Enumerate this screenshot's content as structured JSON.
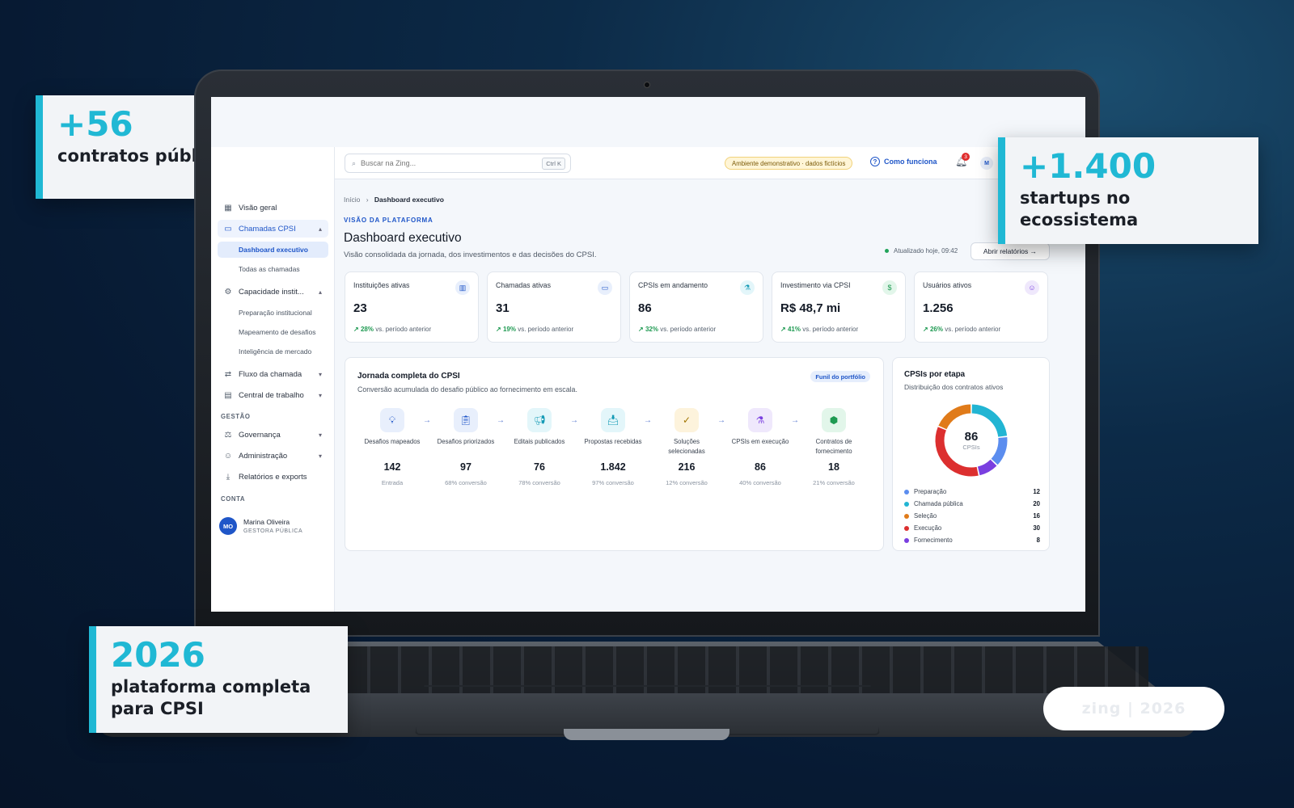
{
  "callouts": {
    "contracts": {
      "value": "+56",
      "label": "contratos públicos"
    },
    "startups": {
      "value": "+1.400",
      "label_line1": "startups no",
      "label_line2": "ecossistema"
    },
    "year": {
      "value": "2026",
      "label_line1": "plataforma completa",
      "label_line2": "para CPSI"
    }
  },
  "watermark": "zing | 2026",
  "topbar": {
    "search_placeholder": "Buscar na Zing...",
    "search_shortcut": "Ctrl K",
    "demo_badge": "Ambiente demonstrativo · dados fictícios",
    "how_it_works": "Como funciona",
    "notification_count": "3",
    "avatar_initial": "M"
  },
  "sidebar": {
    "items": [
      {
        "label": "Visão geral",
        "icon": "grid-icon"
      },
      {
        "label": "Chamadas CPSI",
        "icon": "folder-icon"
      },
      {
        "label": "Dashboard executivo"
      },
      {
        "label": "Todas as chamadas"
      },
      {
        "label": "Capacidade instit...",
        "icon": "sliders-icon"
      },
      {
        "label": "Preparação institucional"
      },
      {
        "label": "Mapeamento de desafios"
      },
      {
        "label": "Inteligência de mercado"
      },
      {
        "label": "Fluxo da chamada",
        "icon": "flow-icon"
      },
      {
        "label": "Central de trabalho",
        "icon": "calendar-icon"
      },
      {
        "label": "Governança",
        "icon": "gavel-icon"
      },
      {
        "label": "Administração",
        "icon": "users-icon"
      },
      {
        "label": "Relatórios e exports",
        "icon": "download-icon"
      }
    ],
    "section_gestao": "GESTÃO",
    "section_conta": "CONTA",
    "user": {
      "initials": "MO",
      "name": "Marina Oliveira",
      "role": "GESTORA PÚBLICA"
    }
  },
  "main": {
    "breadcrumb_home": "Início",
    "breadcrumb_current": "Dashboard executivo",
    "eyebrow": "VISÃO DA PLATAFORMA",
    "title": "Dashboard executivo",
    "subtitle": "Visão consolidada da jornada, dos investimentos e das decisões do CPSI.",
    "updated": "Atualizado hoje, 09:42",
    "open_reports": "Abrir relatórios →",
    "kpis": [
      {
        "label": "Instituições ativas",
        "value": "23",
        "delta": "28%",
        "delta_text": "vs. período anterior",
        "icon": "building-icon"
      },
      {
        "label": "Chamadas ativas",
        "value": "31",
        "delta": "19%",
        "delta_text": "vs. período anterior",
        "icon": "folder-icon"
      },
      {
        "label": "CPSIs em andamento",
        "value": "86",
        "delta": "32%",
        "delta_text": "vs. período anterior",
        "icon": "flask-icon"
      },
      {
        "label": "Investimento via CPSI",
        "value": "R$ 48,7 mi",
        "delta": "41%",
        "delta_text": "vs. período anterior",
        "icon": "dollar-icon"
      },
      {
        "label": "Usuários ativos",
        "value": "1.256",
        "delta": "26%",
        "delta_text": "vs. período anterior",
        "icon": "users-icon"
      }
    ],
    "journey": {
      "title": "Jornada completa do CPSI",
      "subtitle": "Conversão acumulada do desafio público ao fornecimento em escala.",
      "badge": "Funil do portfólio",
      "stages": [
        {
          "name": "Desafios mapeados",
          "value": "142",
          "caption": "Entrada",
          "icon": "lightbulb-icon"
        },
        {
          "name": "Desafios priorizados",
          "value": "97",
          "caption": "68% conversão",
          "icon": "clipboard-icon"
        },
        {
          "name": "Editais publicados",
          "value": "76",
          "caption": "78% conversão",
          "icon": "megaphone-icon"
        },
        {
          "name": "Propostas recebidas",
          "value": "1.842",
          "caption": "97% conversão",
          "icon": "inbox-icon"
        },
        {
          "name": "Soluções selecionadas",
          "value": "216",
          "caption": "12% conversão",
          "icon": "check-circle-icon"
        },
        {
          "name": "CPSIs em execução",
          "value": "86",
          "caption": "40% conversão",
          "icon": "flask-icon"
        },
        {
          "name": "Contratos de fornecimento",
          "value": "18",
          "caption": "21% conversão",
          "icon": "package-icon"
        }
      ]
    },
    "donut": {
      "title": "CPSIs por etapa",
      "subtitle": "Distribuição dos contratos ativos",
      "center_value": "86",
      "center_label": "CPSIs"
    }
  },
  "chart_data": {
    "type": "pie",
    "categories": [
      "Preparação",
      "Chamada pública",
      "Seleção",
      "Execução",
      "Fornecimento"
    ],
    "values": [
      12,
      20,
      16,
      30,
      8
    ],
    "colors": [
      "#5b8def",
      "#22b5d3",
      "#e07b1a",
      "#dc2f2f",
      "#7a3fe0"
    ]
  }
}
